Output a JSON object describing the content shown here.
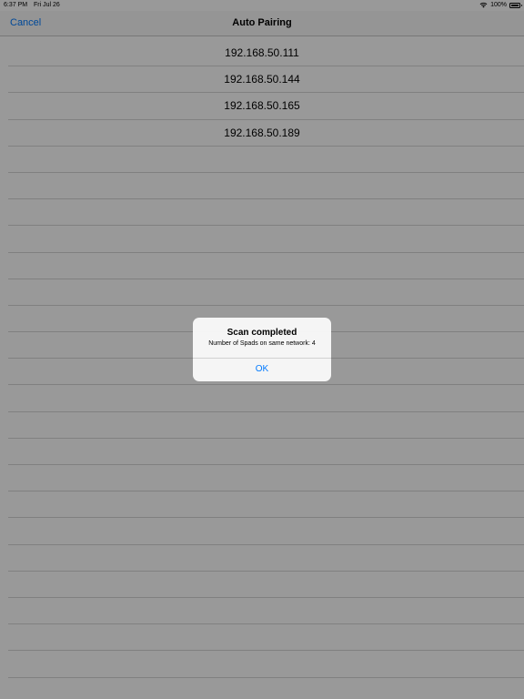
{
  "status_bar": {
    "time": "6:37 PM",
    "date": "Fri Jul 26",
    "battery": "100%",
    "wifi_icon": "wifi-icon",
    "battery_icon": "battery-icon"
  },
  "nav": {
    "cancel_label": "Cancel",
    "title": "Auto Pairing"
  },
  "devices": [
    "192.168.50.111",
    "192.168.50.144",
    "192.168.50.165",
    "192.168.50.189"
  ],
  "alert": {
    "title": "Scan completed",
    "message": "Number of Spads on same network: 4",
    "ok_label": "OK"
  },
  "colors": {
    "accent": "#007aff",
    "overlay": "rgba(0,0,0,0.40)",
    "separator": "#d6d6d6"
  }
}
